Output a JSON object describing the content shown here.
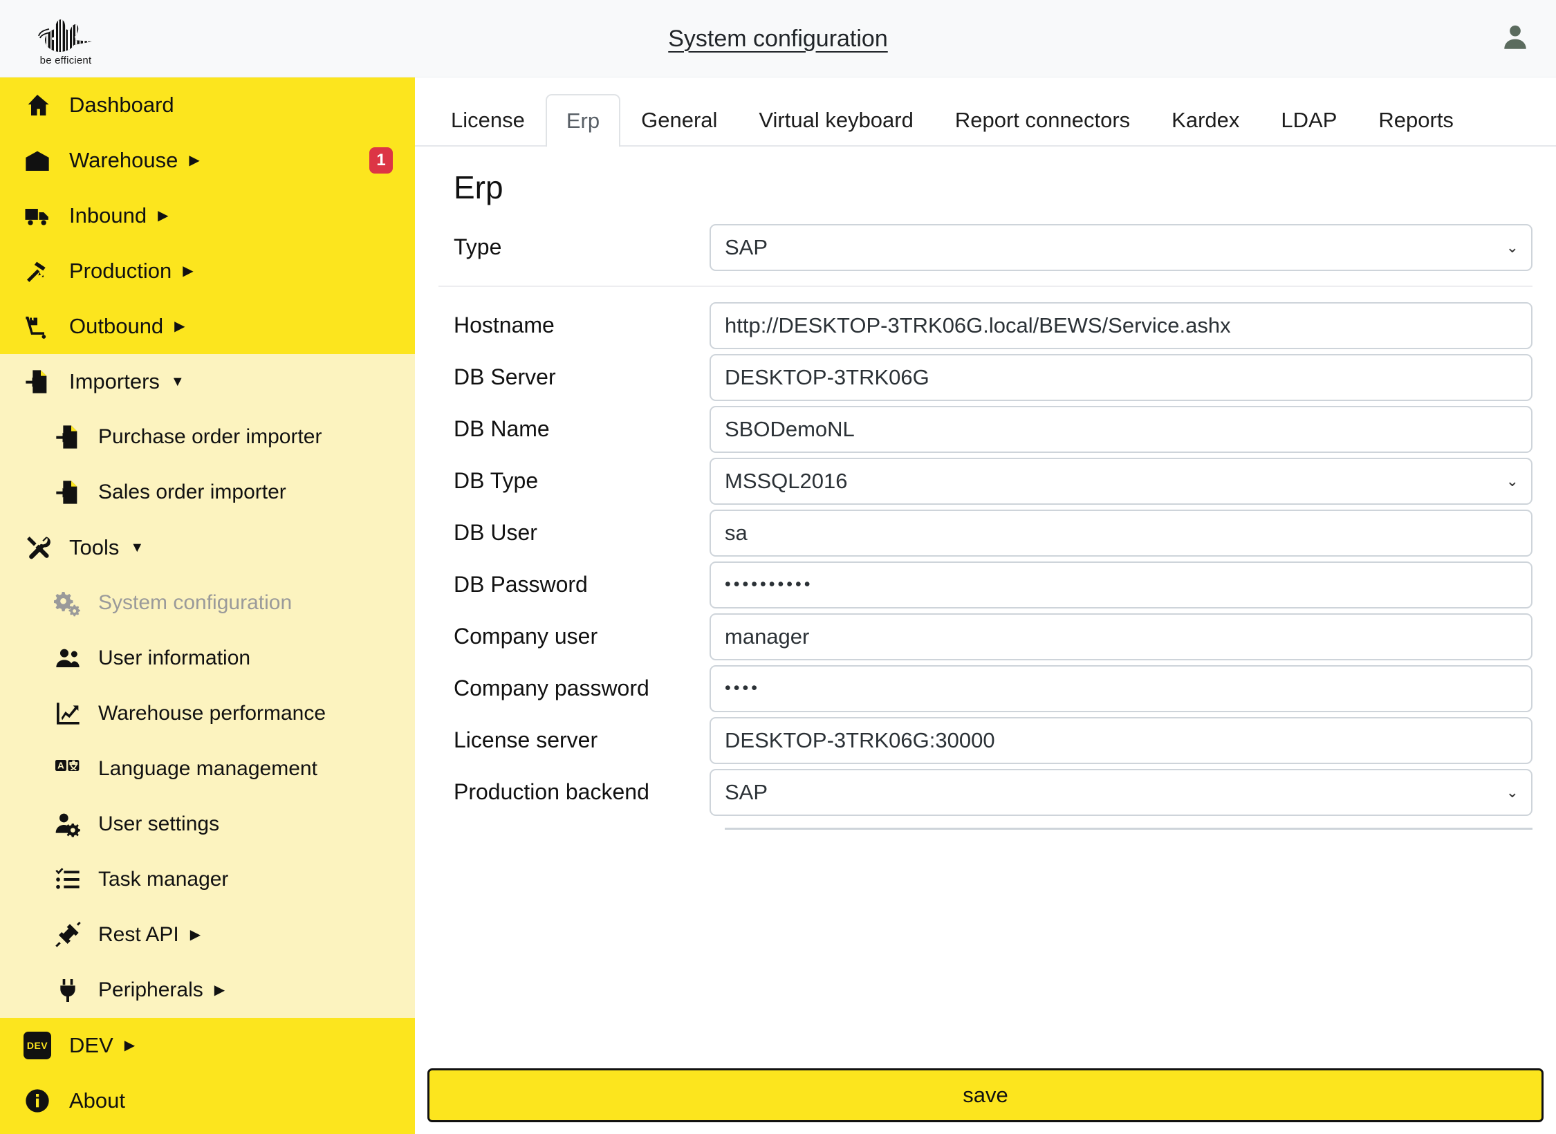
{
  "topbar": {
    "title": "System configuration",
    "logo_tagline": "be efficient",
    "user_icon": "user-avatar-icon"
  },
  "sidebar": {
    "items": [
      {
        "label": "Dashboard",
        "icon": "home-icon",
        "level": 0,
        "caret": "",
        "badge": "",
        "shade": "bright",
        "state": "normal"
      },
      {
        "label": "Warehouse",
        "icon": "warehouse-icon",
        "level": 0,
        "caret": "▶",
        "badge": "1",
        "shade": "bright",
        "state": "normal"
      },
      {
        "label": "Inbound",
        "icon": "truck-icon",
        "level": 0,
        "caret": "▶",
        "badge": "",
        "shade": "bright",
        "state": "normal"
      },
      {
        "label": "Production",
        "icon": "hammer-icon",
        "level": 0,
        "caret": "▶",
        "badge": "",
        "shade": "bright",
        "state": "normal"
      },
      {
        "label": "Outbound",
        "icon": "dolly-icon",
        "level": 0,
        "caret": "▶",
        "badge": "",
        "shade": "bright",
        "state": "normal"
      },
      {
        "label": "Importers",
        "icon": "import-file-icon",
        "level": 0,
        "caret": "▼",
        "badge": "",
        "shade": "light",
        "state": "normal"
      },
      {
        "label": "Purchase order importer",
        "icon": "import-file-icon",
        "level": 1,
        "caret": "",
        "badge": "",
        "shade": "light",
        "state": "normal"
      },
      {
        "label": "Sales order importer",
        "icon": "import-file-icon",
        "level": 1,
        "caret": "",
        "badge": "",
        "shade": "light",
        "state": "normal"
      },
      {
        "label": "Tools",
        "icon": "tools-icon",
        "level": 0,
        "caret": "▼",
        "badge": "",
        "shade": "light",
        "state": "normal"
      },
      {
        "label": "System configuration",
        "icon": "gears-icon",
        "level": 1,
        "caret": "",
        "badge": "",
        "shade": "light",
        "state": "disabled"
      },
      {
        "label": "User information",
        "icon": "users-icon",
        "level": 1,
        "caret": "",
        "badge": "",
        "shade": "light",
        "state": "normal"
      },
      {
        "label": "Warehouse performance",
        "icon": "chart-line-icon",
        "level": 1,
        "caret": "",
        "badge": "",
        "shade": "light",
        "state": "normal"
      },
      {
        "label": "Language management",
        "icon": "translate-icon",
        "level": 1,
        "caret": "",
        "badge": "",
        "shade": "light",
        "state": "normal"
      },
      {
        "label": "User settings",
        "icon": "user-gear-icon",
        "level": 1,
        "caret": "",
        "badge": "",
        "shade": "light",
        "state": "normal"
      },
      {
        "label": "Task manager",
        "icon": "tasklist-icon",
        "level": 1,
        "caret": "",
        "badge": "",
        "shade": "light",
        "state": "normal"
      },
      {
        "label": "Rest API",
        "icon": "plug-connect-icon",
        "level": 1,
        "caret": "▶",
        "badge": "",
        "shade": "light",
        "state": "normal"
      },
      {
        "label": "Peripherals",
        "icon": "power-plug-icon",
        "level": 1,
        "caret": "▶",
        "badge": "",
        "shade": "light",
        "state": "normal"
      },
      {
        "label": "DEV",
        "icon": "dev-chip-icon",
        "level": 0,
        "caret": "▶",
        "badge": "",
        "shade": "bright",
        "state": "normal"
      },
      {
        "label": "About",
        "icon": "info-icon",
        "level": 0,
        "caret": "",
        "badge": "",
        "shade": "bright",
        "state": "normal"
      }
    ]
  },
  "main": {
    "tabs": [
      {
        "label": "License",
        "active": false
      },
      {
        "label": "Erp",
        "active": true
      },
      {
        "label": "General",
        "active": false
      },
      {
        "label": "Virtual keyboard",
        "active": false
      },
      {
        "label": "Report connectors",
        "active": false
      },
      {
        "label": "Kardex",
        "active": false
      },
      {
        "label": "LDAP",
        "active": false
      },
      {
        "label": "Reports",
        "active": false
      }
    ],
    "panel_title": "Erp",
    "fields": [
      {
        "label": "Type",
        "value": "SAP",
        "type": "select"
      },
      {
        "label": "Hostname",
        "value": "http://DESKTOP-3TRK06G.local/BEWS/Service.ashx",
        "type": "text"
      },
      {
        "label": "DB Server",
        "value": "DESKTOP-3TRK06G",
        "type": "text"
      },
      {
        "label": "DB Name",
        "value": "SBODemoNL",
        "type": "text"
      },
      {
        "label": "DB Type",
        "value": "MSSQL2016",
        "type": "select"
      },
      {
        "label": "DB User",
        "value": "sa",
        "type": "text"
      },
      {
        "label": "DB Password",
        "value": "••••••••••",
        "type": "password"
      },
      {
        "label": "Company user",
        "value": "manager",
        "type": "text"
      },
      {
        "label": "Company password",
        "value": "••••",
        "type": "password"
      },
      {
        "label": "License server",
        "value": "DESKTOP-3TRK06G:30000",
        "type": "text"
      },
      {
        "label": "Production backend",
        "value": "SAP",
        "type": "select"
      }
    ],
    "save_label": "save"
  },
  "colors": {
    "brand_yellow": "#FCE51E",
    "brand_yellow_light": "#FCF3BF",
    "badge_red": "#DC3545",
    "topbar_bg": "#F8F9FA",
    "field_border": "#CED4DA"
  }
}
